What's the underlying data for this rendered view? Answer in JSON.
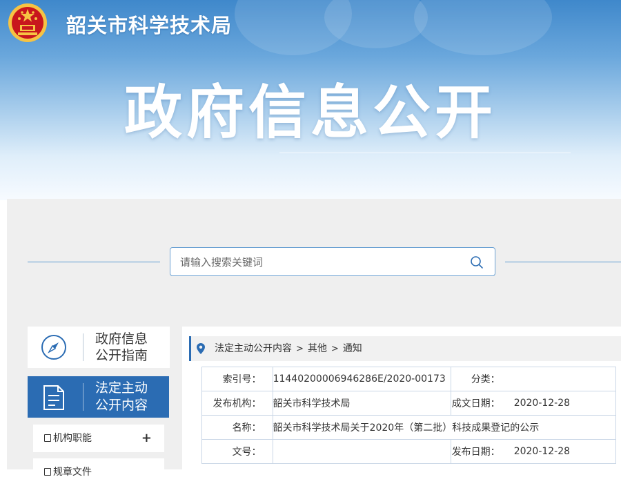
{
  "header": {
    "site_name": "韶关市科学技术局",
    "banner_title": "政府信息公开"
  },
  "search": {
    "placeholder": "请输入搜索关键词",
    "value": ""
  },
  "sidebar": {
    "guide_label": "政府信息公开指南",
    "guide_lines": [
      "政府信息",
      "公开指南"
    ],
    "legal_lines": [
      "法定主动",
      "公开内容"
    ],
    "items": [
      {
        "label": "机构职能",
        "toggle": "+"
      },
      {
        "label": "规章文件",
        "toggle": ""
      }
    ]
  },
  "breadcrumb": {
    "items": [
      "法定主动公开内容",
      "其他",
      "通知"
    ]
  },
  "meta": {
    "index_no_label": "索引号：",
    "index_no": "11440200006946286E/2020-00173",
    "category_label": "分类：",
    "category": "",
    "publisher_label": "发布机构：",
    "publisher": "韶关市科学技术局",
    "created_label": "成文日期：",
    "created": "2020-12-28",
    "name_label": "名称：",
    "name": "韶关市科学技术局关于2020年（第二批）科技成果登记的公示",
    "doc_no_label": "文号：",
    "doc_no": "",
    "published_label": "发布日期：",
    "published": "2020-12-28"
  },
  "colors": {
    "accent": "#2b6cb3",
    "border": "#c9d6e6",
    "emblem_red": "#c8161d",
    "emblem_gold": "#f6c343"
  },
  "icons": [
    "national-emblem-icon",
    "search-icon",
    "compass-icon",
    "document-icon",
    "location-pin-icon",
    "square-icon"
  ]
}
